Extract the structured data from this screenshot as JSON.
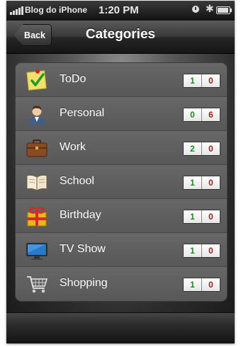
{
  "status_bar": {
    "carrier": "Blog do iPhone",
    "time": "1:20 PM",
    "bluetooth_glyph": "✱"
  },
  "nav": {
    "back_label": "Back",
    "title": "Categories"
  },
  "categories": [
    {
      "label": "ToDo",
      "icon": "todo-note-icon",
      "done": "1",
      "open": "0"
    },
    {
      "label": "Personal",
      "icon": "person-icon",
      "done": "0",
      "open": "6"
    },
    {
      "label": "Work",
      "icon": "briefcase-icon",
      "done": "2",
      "open": "0"
    },
    {
      "label": "School",
      "icon": "open-book-icon",
      "done": "1",
      "open": "0"
    },
    {
      "label": "Birthday",
      "icon": "gift-icon",
      "done": "1",
      "open": "0"
    },
    {
      "label": "TV Show",
      "icon": "television-icon",
      "done": "1",
      "open": "0"
    },
    {
      "label": "Shopping",
      "icon": "shopping-cart-icon",
      "done": "1",
      "open": "0"
    }
  ],
  "colors": {
    "done_count": "#1f8a1f",
    "open_count": "#9b1d1d"
  }
}
